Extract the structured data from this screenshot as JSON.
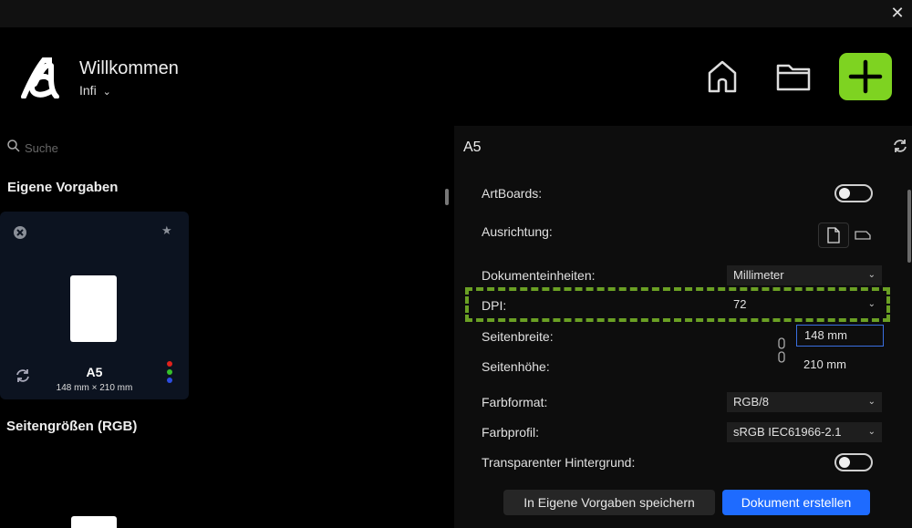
{
  "header": {
    "welcome": "Willkommen",
    "user": "Infi"
  },
  "sidebar": {
    "search_placeholder": "Suche",
    "section_own_presets": "Eigene Vorgaben",
    "section_page_sizes": "Seitengrößen (RGB)",
    "preset": {
      "name": "A5",
      "size": "148 mm × 210 mm",
      "color_dots": [
        "#e0221c",
        "#36c12a",
        "#2d4de0"
      ]
    }
  },
  "settings": {
    "title": "A5",
    "artboards_label": "ArtBoards:",
    "artboards_on": false,
    "orientation_label": "Ausrichtung:",
    "units_label": "Dokumenteinheiten:",
    "units_value": "Millimeter",
    "dpi_label": "DPI:",
    "dpi_value": "72",
    "width_label": "Seitenbreite:",
    "width_value": "148 mm",
    "height_label": "Seitenhöhe:",
    "height_value": "210 mm",
    "color_format_label": "Farbformat:",
    "color_format_value": "RGB/8",
    "color_profile_label": "Farbprofil:",
    "color_profile_value": "sRGB IEC61966-2.1",
    "transparent_label": "Transparenter Hintergrund:",
    "transparent_on": false
  },
  "buttons": {
    "save_preset": "In Eigene Vorgaben speichern",
    "create_document": "Dokument erstellen"
  },
  "colors": {
    "accent_green": "#7ed321",
    "primary_blue": "#1e6bff",
    "highlight_dash": "#6aa024"
  }
}
